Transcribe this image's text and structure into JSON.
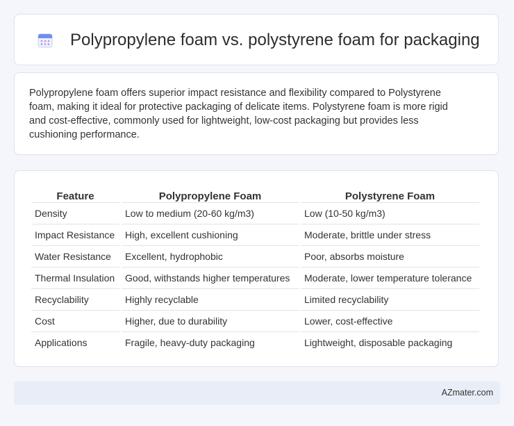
{
  "header": {
    "title": "Polypropylene foam vs. polystyrene foam for packaging",
    "icon": "calendar-icon"
  },
  "description": "Polypropylene foam offers superior impact resistance and flexibility compared to Polystyrene foam, making it ideal for protective packaging of delicate items. Polystyrene foam is more rigid and cost-effective, commonly used for lightweight, low-cost packaging but provides less cushioning performance.",
  "table": {
    "headers": [
      "Feature",
      "Polypropylene Foam",
      "Polystyrene Foam"
    ],
    "rows": [
      [
        "Density",
        "Low to medium (20-60 kg/m3)",
        "Low (10-50 kg/m3)"
      ],
      [
        "Impact Resistance",
        "High, excellent cushioning",
        "Moderate, brittle under stress"
      ],
      [
        "Water Resistance",
        "Excellent, hydrophobic",
        "Poor, absorbs moisture"
      ],
      [
        "Thermal Insulation",
        "Good, withstands higher temperatures",
        "Moderate, lower temperature tolerance"
      ],
      [
        "Recyclability",
        "Highly recyclable",
        "Limited recyclability"
      ],
      [
        "Cost",
        "Higher, due to durability",
        "Lower, cost-effective"
      ],
      [
        "Applications",
        "Fragile, heavy-duty packaging",
        "Lightweight, disposable packaging"
      ]
    ]
  },
  "footer": {
    "site": "AZmater.com"
  },
  "colors": {
    "background": "#f4f6fb",
    "footer_bg": "#e8edf7",
    "icon_accent": "#5b7de8"
  }
}
